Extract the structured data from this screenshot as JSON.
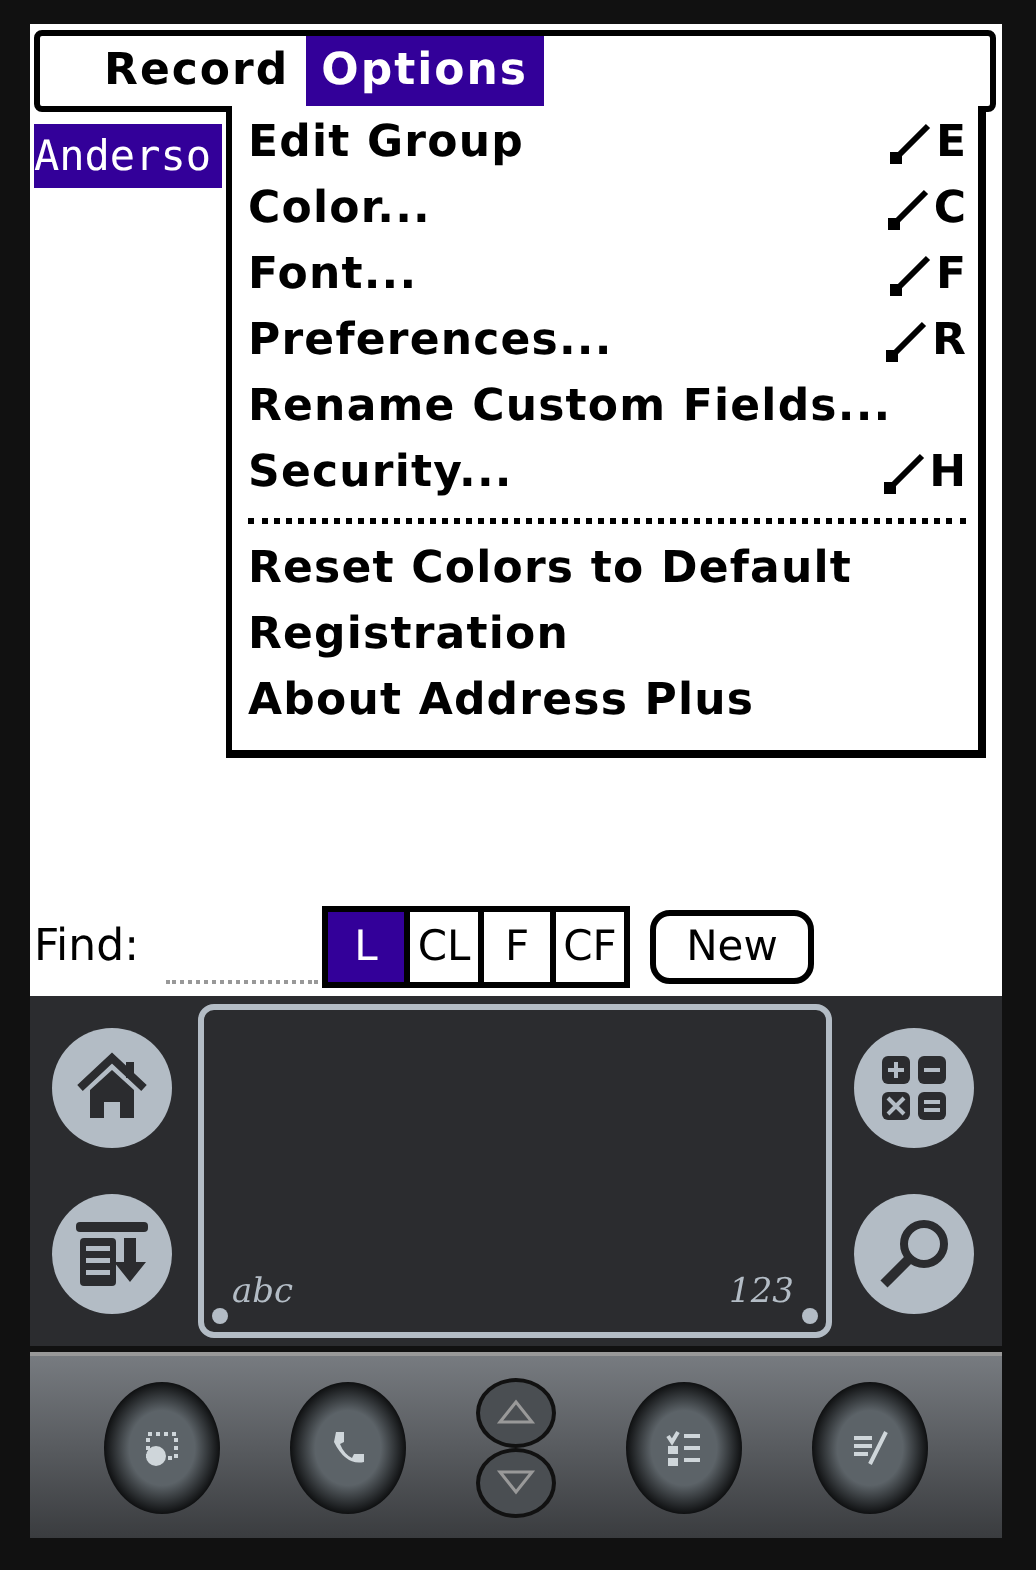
{
  "menubar": [
    {
      "label": "Record",
      "selected": false
    },
    {
      "label": "Options",
      "selected": true
    }
  ],
  "list": [
    {
      "name": "Anderso",
      "selected": true
    }
  ],
  "menu": {
    "items": [
      {
        "kind": "item",
        "label": "Edit Group",
        "shortcut": "E"
      },
      {
        "kind": "item",
        "label": "Color...",
        "shortcut": "C"
      },
      {
        "kind": "item",
        "label": "Font...",
        "shortcut": "F"
      },
      {
        "kind": "item",
        "label": "Preferences...",
        "shortcut": "R"
      },
      {
        "kind": "item",
        "label": "Rename Custom Fields..."
      },
      {
        "kind": "item",
        "label": "Security...",
        "shortcut": "H"
      },
      {
        "kind": "divider"
      },
      {
        "kind": "item",
        "label": "Reset Colors to Default"
      },
      {
        "kind": "item",
        "label": "Registration"
      },
      {
        "kind": "item",
        "label": "About Address Plus"
      }
    ]
  },
  "find": {
    "label": "Find:"
  },
  "filters": [
    {
      "label": "L",
      "selected": true
    },
    {
      "label": "CL",
      "selected": false
    },
    {
      "label": "F",
      "selected": false
    },
    {
      "label": "CF",
      "selected": false
    }
  ],
  "new_button": "New",
  "silkscreen": {
    "letters_label": "abc",
    "numbers_label": "123"
  }
}
